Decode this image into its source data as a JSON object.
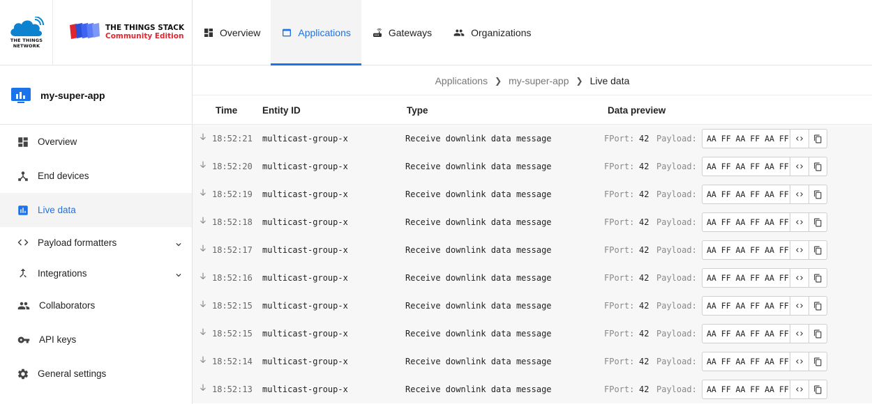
{
  "brand": {
    "ttn_line1": "THE THINGS",
    "ttn_line2": "NETWORK",
    "stack_line1": "THE THINGS STACK",
    "stack_line2": "Community Edition"
  },
  "topnav": [
    {
      "label": "Overview",
      "icon": "dashboard-icon"
    },
    {
      "label": "Applications",
      "icon": "window-icon",
      "active": true
    },
    {
      "label": "Gateways",
      "icon": "router-icon"
    },
    {
      "label": "Organizations",
      "icon": "people-icon"
    }
  ],
  "app": {
    "name": "my-super-app"
  },
  "sidebar": [
    {
      "label": "Overview",
      "icon": "dashboard-icon"
    },
    {
      "label": "End devices",
      "icon": "device-hub-icon"
    },
    {
      "label": "Live data",
      "icon": "bar-chart-icon",
      "active": true
    },
    {
      "label": "Payload formatters",
      "icon": "code-icon"
    },
    {
      "label": "Integrations",
      "icon": "merge-icon"
    },
    {
      "label": "Collaborators",
      "icon": "people-icon"
    },
    {
      "label": "API keys",
      "icon": "key-icon"
    },
    {
      "label": "General settings",
      "icon": "gear-icon"
    }
  ],
  "breadcrumb": [
    "Applications",
    "my-super-app",
    "Live data"
  ],
  "table": {
    "headers": {
      "time": "Time",
      "entity": "Entity ID",
      "type": "Type",
      "preview": "Data preview"
    },
    "fport_label": "FPort:",
    "payload_label": "Payload:",
    "rows": [
      {
        "time": "18:52:21",
        "entity": "multicast-group-x",
        "type": "Receive downlink data message",
        "fport": "42",
        "payload": "AA FF AA FF AA FF"
      },
      {
        "time": "18:52:20",
        "entity": "multicast-group-x",
        "type": "Receive downlink data message",
        "fport": "42",
        "payload": "AA FF AA FF AA FF"
      },
      {
        "time": "18:52:19",
        "entity": "multicast-group-x",
        "type": "Receive downlink data message",
        "fport": "42",
        "payload": "AA FF AA FF AA FF"
      },
      {
        "time": "18:52:18",
        "entity": "multicast-group-x",
        "type": "Receive downlink data message",
        "fport": "42",
        "payload": "AA FF AA FF AA FF"
      },
      {
        "time": "18:52:17",
        "entity": "multicast-group-x",
        "type": "Receive downlink data message",
        "fport": "42",
        "payload": "AA FF AA FF AA FF"
      },
      {
        "time": "18:52:16",
        "entity": "multicast-group-x",
        "type": "Receive downlink data message",
        "fport": "42",
        "payload": "AA FF AA FF AA FF"
      },
      {
        "time": "18:52:15",
        "entity": "multicast-group-x",
        "type": "Receive downlink data message",
        "fport": "42",
        "payload": "AA FF AA FF AA FF"
      },
      {
        "time": "18:52:15",
        "entity": "multicast-group-x",
        "type": "Receive downlink data message",
        "fport": "42",
        "payload": "AA FF AA FF AA FF"
      },
      {
        "time": "18:52:14",
        "entity": "multicast-group-x",
        "type": "Receive downlink data message",
        "fport": "42",
        "payload": "AA FF AA FF AA FF"
      },
      {
        "time": "18:52:13",
        "entity": "multicast-group-x",
        "type": "Receive downlink data message",
        "fport": "42",
        "payload": "AA FF AA FF AA FF"
      }
    ]
  },
  "colors": {
    "accent": "#1a73e8",
    "brand_red": "#e0262f",
    "cloud_blue": "#0d83d0"
  }
}
